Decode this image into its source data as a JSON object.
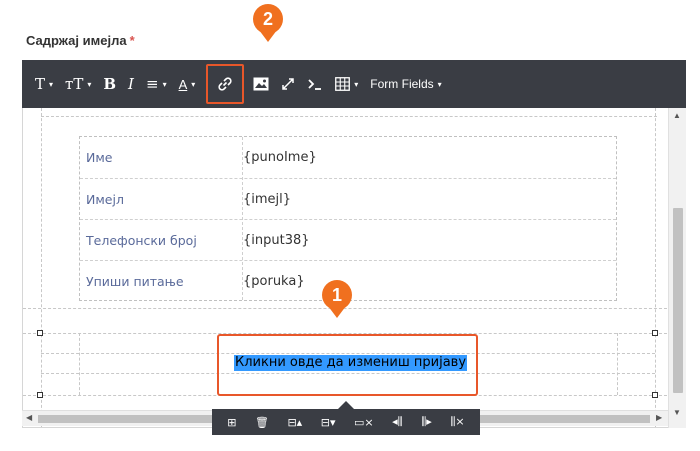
{
  "field": {
    "label": "Садржај имејла",
    "required_mark": "*"
  },
  "toolbar": {
    "heading": "T",
    "font_size": "тT",
    "bold": "B",
    "italic": "I",
    "align": "≡",
    "text_color": "A",
    "caret": "▾",
    "form_fields": "Form Fields"
  },
  "form_table": {
    "rows": [
      {
        "label": "Име",
        "value": "{punoIme}"
      },
      {
        "label": "Имејл",
        "value": "{imejl}"
      },
      {
        "label": "Телефонски број",
        "value": "{input38}"
      },
      {
        "label": "Упиши питање",
        "value": "{poruka}"
      }
    ]
  },
  "selected_link_text": "Кликни овде да измениш пријаву",
  "callouts": {
    "first": "1",
    "second": "2"
  },
  "colors": {
    "toolbar_bg": "#3a3d44",
    "callout": "#f0701f",
    "highlight_border": "#e8572a",
    "selection": "#3399ff",
    "required": "#d9534f"
  }
}
